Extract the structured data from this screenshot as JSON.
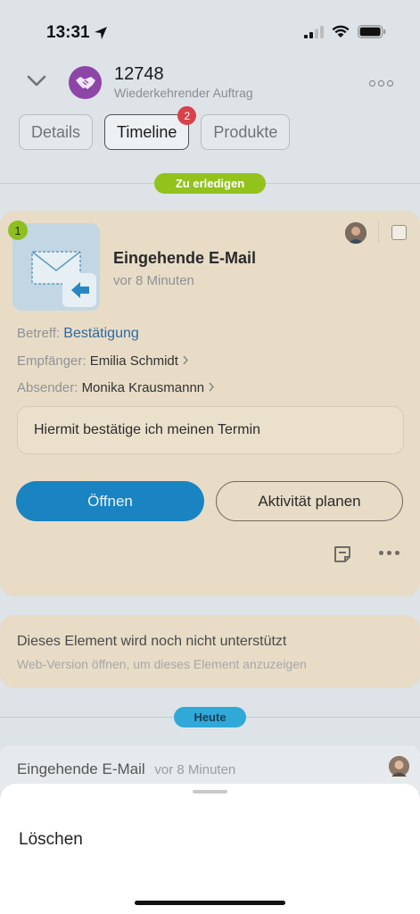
{
  "status_bar": {
    "time": "13:31"
  },
  "header": {
    "title": "12748",
    "subtitle": "Wiederkehrender Auftrag"
  },
  "tabs": [
    {
      "label": "Details"
    },
    {
      "label": "Timeline",
      "badge": "2"
    },
    {
      "label": "Produkte"
    }
  ],
  "timeline": {
    "todo_pill": "Zu erledigen",
    "activity": {
      "number": "1",
      "title": "Eingehende E-Mail",
      "time": "vor 8 Minuten",
      "subject_label": "Betreff:",
      "subject_value": "Bestätigung",
      "recipient_label": "Empfänger:",
      "recipient_value": "Emilia Schmidt",
      "sender_label": "Absender:",
      "sender_value": "Monika Krausmannn",
      "message": "Hiermit bestätige ich meinen Termin",
      "open_button": "Öffnen",
      "plan_button": "Aktivität planen"
    },
    "unsupported": {
      "title": "Dieses Element wird noch nicht unterstützt",
      "subtitle": "Web-Version öffnen, um dieses Element anzuzeigen"
    },
    "today_pill": "Heute",
    "history_item": {
      "title": "Eingehende E-Mail",
      "time": "vor 8 Minuten"
    }
  },
  "sheet": {
    "item": "Löschen"
  },
  "colors": {
    "accent": "#1a83c2",
    "todo_green": "#93c21d",
    "today_blue": "#30a8d8",
    "badge_red": "#d9414a",
    "deal_purple": "#8e45a8"
  },
  "icons": [
    "location-arrow-icon",
    "signal-icon",
    "wifi-icon",
    "battery-icon",
    "chevron-down-icon",
    "handshake-icon",
    "more-horizontal-icon",
    "email-incoming-icon",
    "checkbox-icon",
    "chevron-right-icon",
    "note-icon"
  ]
}
